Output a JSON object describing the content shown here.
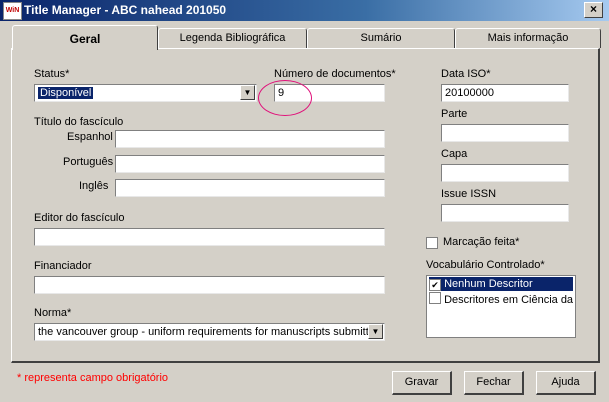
{
  "window": {
    "title": "Title Manager - ABC nahead 201050",
    "icon_text": "WiN"
  },
  "tabs": [
    {
      "label": "Geral"
    },
    {
      "label": "Legenda Bibliográfica"
    },
    {
      "label": "Sumário"
    },
    {
      "label": "Mais informação"
    }
  ],
  "form": {
    "status_label": "Status*",
    "status_value": "Disponível",
    "numero_label": "Número de documentos*",
    "numero_value": "9",
    "data_iso_label": "Data ISO*",
    "data_iso_value": "20100000",
    "titulo_label": "Título do fascículo",
    "espanhol_label": "Espanhol",
    "espanhol_value": "",
    "portugues_label": "Português",
    "portugues_value": "",
    "ingles_label": "Inglês",
    "ingles_value": "",
    "parte_label": "Parte",
    "parte_value": "",
    "capa_label": "Capa",
    "capa_value": "",
    "issue_issn_label": "Issue ISSN",
    "issue_issn_value": "",
    "editor_label": "Editor do fascículo",
    "editor_value": "",
    "marcacao_label": "Marcação feita*",
    "marcacao_checked": false,
    "financiador_label": "Financiador",
    "financiador_value": "",
    "vocab_label": "Vocabulário Controlado*",
    "vocab_items": [
      {
        "label": "Nenhum Descritor",
        "checked": true
      },
      {
        "label": "Descritores em Ciência da S",
        "checked": false
      }
    ],
    "norma_label": "Norma*",
    "norma_value": "the vancouver group - uniform requirements for manuscripts submitted"
  },
  "footer": {
    "required_note": "* representa campo obrigatório",
    "gravar": "Gravar",
    "fechar": "Fechar",
    "ajuda": "Ajuda"
  },
  "colors": {
    "titlebar": "#0a246a",
    "annotation": "#e0107a",
    "required": "#ff0000",
    "selection": "#0a246a"
  }
}
